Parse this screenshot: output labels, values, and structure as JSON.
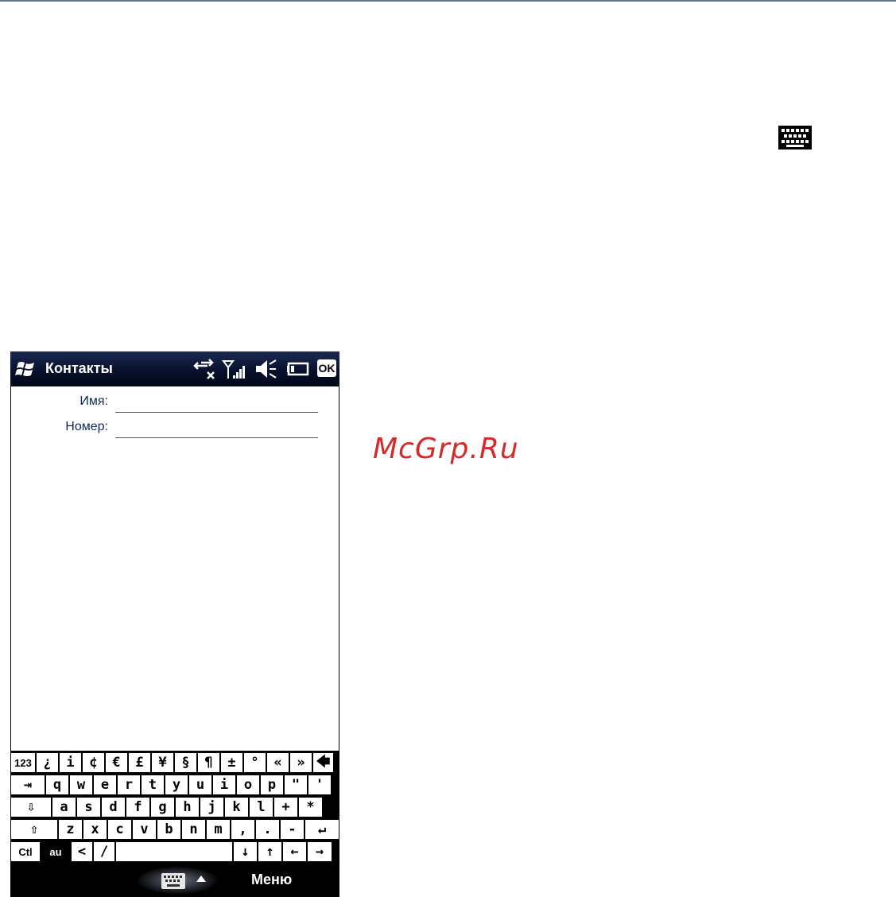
{
  "colors": {
    "title_bar": "#08112e",
    "field_label": "#10265a",
    "watermark": "#d42a2a"
  },
  "watermark": "McGrp.Ru",
  "title_bar": {
    "title": "Контакты",
    "ok_label": "OK",
    "icons": [
      "windows-start-icon",
      "data-connection-icon",
      "signal-strength-icon",
      "volume-muted-icon",
      "battery-icon"
    ]
  },
  "form": {
    "name_label": "Имя:",
    "number_label": "Номер:",
    "name_value": "",
    "number_value": ""
  },
  "keyboard": {
    "rows": [
      [
        "123",
        "¿",
        "i",
        "¢",
        "€",
        "£",
        "¥",
        "§",
        "¶",
        "±",
        "°",
        "«",
        "»",
        "🡄"
      ],
      [
        "⇥",
        "q",
        "w",
        "e",
        "r",
        "t",
        "y",
        "u",
        "i",
        "o",
        "p",
        "\"",
        "'"
      ],
      [
        "⇩",
        "a",
        "s",
        "d",
        "f",
        "g",
        "h",
        "j",
        "k",
        "l",
        "+",
        "*"
      ],
      [
        "⇧",
        "z",
        "x",
        "c",
        "v",
        "b",
        "n",
        "m",
        ",",
        ".",
        "-",
        "↵"
      ],
      [
        "Ctl",
        "au",
        "<",
        "/",
        "",
        "↓",
        "↑",
        "←",
        "→"
      ]
    ]
  },
  "menu_bar": {
    "right_softkey": "Меню"
  }
}
